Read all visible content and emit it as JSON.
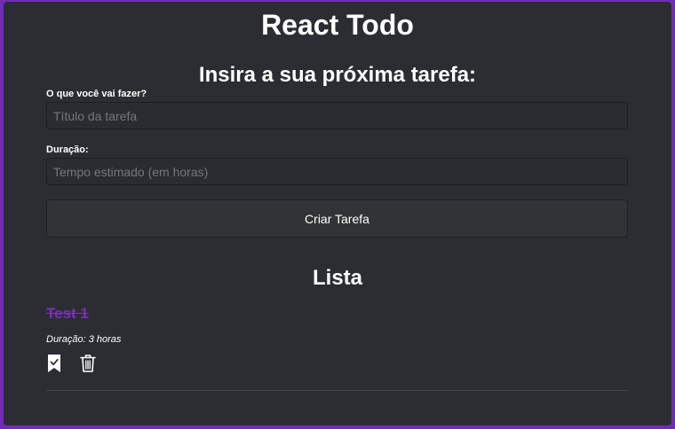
{
  "app": {
    "title": "React Todo"
  },
  "form": {
    "title": "Insira a sua próxima tarefa:",
    "task_label": "O que você vai fazer?",
    "task_placeholder": "Título da tarefa",
    "task_value": "",
    "duration_label": "Duração:",
    "duration_placeholder": "Tempo estimado (em horas)",
    "duration_value": "",
    "submit_label": "Criar Tarefa"
  },
  "list": {
    "title": "Lista",
    "items": [
      {
        "title": "Test 1",
        "duration": "Duração: 3 horas",
        "done": true,
        "complete_icon": "bookmark-check-icon",
        "delete_icon": "trash-icon"
      }
    ]
  },
  "colors": {
    "page_border": "#6f2db3",
    "panel_bg": "#2b2d33",
    "done_title": "#7a2fbf",
    "button_bg": "#323335",
    "placeholder": "#74767c"
  }
}
